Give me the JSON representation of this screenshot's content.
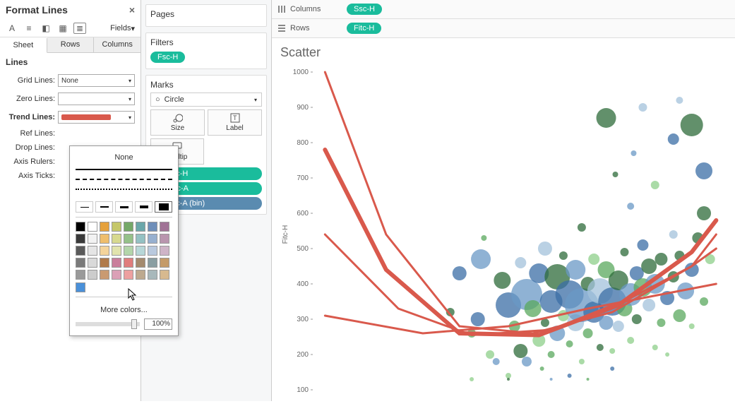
{
  "panel": {
    "title": "Format Lines",
    "fields_label": "Fields",
    "tabs": [
      "Sheet",
      "Rows",
      "Columns"
    ],
    "section": "Lines",
    "lines": {
      "grid": {
        "label": "Grid Lines:",
        "value": "None"
      },
      "zero": {
        "label": "Zero Lines:"
      },
      "trend": {
        "label": "Trend Lines:"
      },
      "ref": {
        "label": "Ref Lines:"
      },
      "drop": {
        "label": "Drop Lines:"
      },
      "rulers": {
        "label": "Axis Rulers:"
      },
      "ticks": {
        "label": "Axis Ticks:"
      }
    }
  },
  "dropdown": {
    "none": "None",
    "more": "More colors...",
    "opacity": "100%",
    "selected_color": "#4a90d9",
    "palette": [
      "#000000",
      "#ffffff",
      "#e5a13c",
      "#c5c76a",
      "#75a868",
      "#6ba7aa",
      "#6f8fb9",
      "#a07295",
      "#3a3a3a",
      "#f2f2f2",
      "#efbe6c",
      "#d7d98f",
      "#95c189",
      "#94c1c3",
      "#97b0cf",
      "#b995ae",
      "#5a5a5a",
      "#e5e5e5",
      "#f4d49b",
      "#e1e3ad",
      "#b3d5aa",
      "#b7d7d8",
      "#b9c9de",
      "#ceb4c7",
      "#7a7a7a",
      "#d9d9d9",
      "#b07a4a",
      "#c97e9b",
      "#e07d7d",
      "#a48a6e",
      "#8a9ea2",
      "#c49b69",
      "#9a9a9a",
      "#cccccc",
      "#c99a71",
      "#dba0b6",
      "#eda0a0",
      "#bda98f",
      "#a8b8bb",
      "#d7b98f"
    ]
  },
  "mid": {
    "pages": "Pages",
    "filters": "Filters",
    "filter_pill": "Fsc-H",
    "marks": "Marks",
    "mark_type": "Circle",
    "buttons": {
      "size": "Size",
      "label": "Label",
      "tooltip": "Tooltip"
    },
    "mark_pills": [
      {
        "label": "Fsc-H",
        "class": "pill"
      },
      {
        "label": "Apc-A",
        "class": "pill"
      },
      {
        "label": "Fsc-A (bin)",
        "class": "pill blue"
      }
    ]
  },
  "shelves": {
    "columns": {
      "label": "Columns",
      "pill": "Ssc-H"
    },
    "rows": {
      "label": "Rows",
      "pill": "Fitc-H"
    }
  },
  "chart_data": {
    "type": "scatter",
    "title": "Scatter",
    "xlabel": "Ssc-H",
    "ylabel": "Fitc-H",
    "xlim": [
      380,
      1050
    ],
    "ylim": [
      100,
      1000
    ],
    "yticks": [
      100,
      200,
      300,
      400,
      500,
      600,
      700,
      800,
      900,
      1000
    ],
    "trend_color": "#d9594c",
    "trend_curves": [
      [
        [
          400,
          1000
        ],
        [
          500,
          540
        ],
        [
          620,
          280
        ],
        [
          740,
          260
        ],
        [
          870,
          320
        ],
        [
          1000,
          450
        ],
        [
          1040,
          540
        ]
      ],
      [
        [
          400,
          780
        ],
        [
          500,
          440
        ],
        [
          620,
          260
        ],
        [
          750,
          255
        ],
        [
          880,
          340
        ],
        [
          1000,
          490
        ],
        [
          1040,
          580
        ]
      ],
      [
        [
          400,
          540
        ],
        [
          520,
          330
        ],
        [
          640,
          255
        ],
        [
          770,
          270
        ],
        [
          900,
          360
        ],
        [
          1000,
          450
        ],
        [
          1040,
          500
        ]
      ],
      [
        [
          400,
          310
        ],
        [
          560,
          260
        ],
        [
          700,
          280
        ],
        [
          830,
          330
        ],
        [
          950,
          370
        ],
        [
          1040,
          400
        ]
      ]
    ],
    "series_colors": [
      "#2e6b3a",
      "#5aa85d",
      "#8dcf8a",
      "#3b6ea5",
      "#6a98c5",
      "#a3c1db"
    ],
    "points": [
      {
        "x": 640,
        "y": 260,
        "r": 6,
        "c": 1
      },
      {
        "x": 650,
        "y": 300,
        "r": 10,
        "c": 3
      },
      {
        "x": 655,
        "y": 470,
        "r": 14,
        "c": 4
      },
      {
        "x": 660,
        "y": 530,
        "r": 4,
        "c": 1
      },
      {
        "x": 670,
        "y": 200,
        "r": 6,
        "c": 2
      },
      {
        "x": 680,
        "y": 180,
        "r": 5,
        "c": 4
      },
      {
        "x": 690,
        "y": 410,
        "r": 12,
        "c": 0
      },
      {
        "x": 700,
        "y": 140,
        "r": 4,
        "c": 2
      },
      {
        "x": 700,
        "y": 340,
        "r": 18,
        "c": 3
      },
      {
        "x": 710,
        "y": 280,
        "r": 8,
        "c": 1
      },
      {
        "x": 640,
        "y": 130,
        "r": 3,
        "c": 2
      },
      {
        "x": 720,
        "y": 210,
        "r": 10,
        "c": 0
      },
      {
        "x": 720,
        "y": 460,
        "r": 8,
        "c": 5
      },
      {
        "x": 730,
        "y": 180,
        "r": 7,
        "c": 4
      },
      {
        "x": 730,
        "y": 370,
        "r": 22,
        "c": 4
      },
      {
        "x": 740,
        "y": 330,
        "r": 12,
        "c": 1
      },
      {
        "x": 750,
        "y": 240,
        "r": 9,
        "c": 2
      },
      {
        "x": 750,
        "y": 430,
        "r": 14,
        "c": 3
      },
      {
        "x": 755,
        "y": 160,
        "r": 3,
        "c": 1
      },
      {
        "x": 760,
        "y": 290,
        "r": 6,
        "c": 0
      },
      {
        "x": 760,
        "y": 500,
        "r": 10,
        "c": 5
      },
      {
        "x": 770,
        "y": 350,
        "r": 16,
        "c": 3
      },
      {
        "x": 770,
        "y": 200,
        "r": 5,
        "c": 1
      },
      {
        "x": 780,
        "y": 260,
        "r": 11,
        "c": 4
      },
      {
        "x": 780,
        "y": 420,
        "r": 18,
        "c": 0
      },
      {
        "x": 790,
        "y": 310,
        "r": 8,
        "c": 2
      },
      {
        "x": 790,
        "y": 480,
        "r": 6,
        "c": 0
      },
      {
        "x": 800,
        "y": 370,
        "r": 20,
        "c": 3
      },
      {
        "x": 800,
        "y": 230,
        "r": 5,
        "c": 1
      },
      {
        "x": 800,
        "y": 140,
        "r": 3,
        "c": 3
      },
      {
        "x": 810,
        "y": 290,
        "r": 12,
        "c": 5
      },
      {
        "x": 810,
        "y": 440,
        "r": 14,
        "c": 4
      },
      {
        "x": 700,
        "y": 130,
        "r": 2,
        "c": 0
      },
      {
        "x": 820,
        "y": 340,
        "r": 24,
        "c": 4
      },
      {
        "x": 820,
        "y": 180,
        "r": 4,
        "c": 2
      },
      {
        "x": 830,
        "y": 400,
        "r": 10,
        "c": 0
      },
      {
        "x": 830,
        "y": 260,
        "r": 7,
        "c": 1
      },
      {
        "x": 840,
        "y": 320,
        "r": 15,
        "c": 3
      },
      {
        "x": 840,
        "y": 470,
        "r": 8,
        "c": 2
      },
      {
        "x": 850,
        "y": 380,
        "r": 18,
        "c": 5
      },
      {
        "x": 850,
        "y": 220,
        "r": 5,
        "c": 0
      },
      {
        "x": 770,
        "y": 130,
        "r": 2,
        "c": 4
      },
      {
        "x": 860,
        "y": 290,
        "r": 10,
        "c": 4
      },
      {
        "x": 860,
        "y": 440,
        "r": 12,
        "c": 1
      },
      {
        "x": 870,
        "y": 350,
        "r": 20,
        "c": 3
      },
      {
        "x": 870,
        "y": 210,
        "r": 4,
        "c": 2
      },
      {
        "x": 880,
        "y": 410,
        "r": 14,
        "c": 0
      },
      {
        "x": 880,
        "y": 280,
        "r": 8,
        "c": 5
      },
      {
        "x": 890,
        "y": 330,
        "r": 11,
        "c": 1
      },
      {
        "x": 890,
        "y": 490,
        "r": 6,
        "c": 0
      },
      {
        "x": 900,
        "y": 370,
        "r": 16,
        "c": 4
      },
      {
        "x": 900,
        "y": 240,
        "r": 5,
        "c": 2
      },
      {
        "x": 910,
        "y": 430,
        "r": 10,
        "c": 3
      },
      {
        "x": 910,
        "y": 300,
        "r": 7,
        "c": 0
      },
      {
        "x": 920,
        "y": 390,
        "r": 13,
        "c": 1
      },
      {
        "x": 920,
        "y": 510,
        "r": 8,
        "c": 3
      },
      {
        "x": 930,
        "y": 340,
        "r": 9,
        "c": 5
      },
      {
        "x": 930,
        "y": 450,
        "r": 11,
        "c": 0
      },
      {
        "x": 940,
        "y": 220,
        "r": 4,
        "c": 2
      },
      {
        "x": 940,
        "y": 400,
        "r": 14,
        "c": 4
      },
      {
        "x": 950,
        "y": 290,
        "r": 6,
        "c": 1
      },
      {
        "x": 950,
        "y": 470,
        "r": 9,
        "c": 0
      },
      {
        "x": 960,
        "y": 360,
        "r": 10,
        "c": 3
      },
      {
        "x": 960,
        "y": 200,
        "r": 3,
        "c": 2
      },
      {
        "x": 970,
        "y": 420,
        "r": 8,
        "c": 0
      },
      {
        "x": 970,
        "y": 540,
        "r": 6,
        "c": 5
      },
      {
        "x": 980,
        "y": 310,
        "r": 9,
        "c": 1
      },
      {
        "x": 980,
        "y": 480,
        "r": 7,
        "c": 0
      },
      {
        "x": 990,
        "y": 380,
        "r": 12,
        "c": 4
      },
      {
        "x": 1000,
        "y": 280,
        "r": 4,
        "c": 2
      },
      {
        "x": 1000,
        "y": 440,
        "r": 10,
        "c": 3
      },
      {
        "x": 1010,
        "y": 530,
        "r": 8,
        "c": 0
      },
      {
        "x": 1020,
        "y": 350,
        "r": 6,
        "c": 1
      },
      {
        "x": 1020,
        "y": 600,
        "r": 10,
        "c": 0
      },
      {
        "x": 1030,
        "y": 470,
        "r": 7,
        "c": 2
      },
      {
        "x": 860,
        "y": 870,
        "r": 14,
        "c": 0
      },
      {
        "x": 920,
        "y": 900,
        "r": 6,
        "c": 5
      },
      {
        "x": 970,
        "y": 810,
        "r": 8,
        "c": 3
      },
      {
        "x": 1000,
        "y": 850,
        "r": 16,
        "c": 0
      },
      {
        "x": 1020,
        "y": 720,
        "r": 12,
        "c": 3
      },
      {
        "x": 940,
        "y": 680,
        "r": 6,
        "c": 2
      },
      {
        "x": 900,
        "y": 620,
        "r": 5,
        "c": 4
      },
      {
        "x": 875,
        "y": 710,
        "r": 4,
        "c": 0
      },
      {
        "x": 820,
        "y": 560,
        "r": 6,
        "c": 0
      },
      {
        "x": 980,
        "y": 920,
        "r": 5,
        "c": 5
      },
      {
        "x": 905,
        "y": 770,
        "r": 4,
        "c": 4
      },
      {
        "x": 620,
        "y": 430,
        "r": 10,
        "c": 3
      },
      {
        "x": 605,
        "y": 320,
        "r": 6,
        "c": 0
      },
      {
        "x": 870,
        "y": 160,
        "r": 3,
        "c": 3
      },
      {
        "x": 830,
        "y": 130,
        "r": 2,
        "c": 1
      }
    ]
  }
}
